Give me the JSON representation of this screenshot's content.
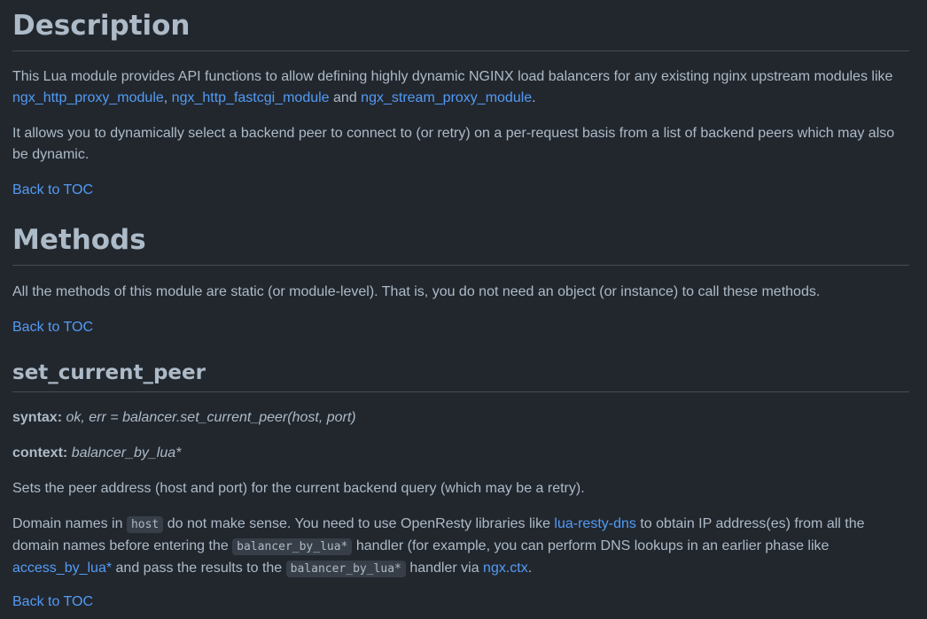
{
  "description": {
    "heading": "Description",
    "p1": {
      "text1": "This Lua module provides API functions to allow defining highly dynamic NGINX load balancers for any existing nginx upstream modules like ",
      "link1": "ngx_http_proxy_module",
      "sep1": ", ",
      "link2": "ngx_http_fastcgi_module",
      "sep2": " and ",
      "link3": "ngx_stream_proxy_module",
      "end": "."
    },
    "p2": "It allows you to dynamically select a backend peer to connect to (or retry) on a per-request basis from a list of backend peers which may also be dynamic.",
    "back_to_toc": "Back to TOC"
  },
  "methods": {
    "heading": "Methods",
    "p1": "All the methods of this module are static (or module-level). That is, you do not need an object (or instance) to call these methods.",
    "back_to_toc": "Back to TOC"
  },
  "set_current_peer": {
    "heading": "set_current_peer",
    "syntax_label": "syntax:",
    "syntax_value": "ok, err = balancer.set_current_peer(host, port)",
    "context_label": "context:",
    "context_value": "balancer_by_lua*",
    "p1": "Sets the peer address (host and port) for the current backend query (which may be a retry).",
    "p2": {
      "t1": "Domain names in ",
      "code1": "host",
      "t2": " do not make sense. You need to use OpenResty libraries like ",
      "link1": "lua-resty-dns",
      "t3": " to obtain IP address(es) from all the domain names before entering the ",
      "code2": "balancer_by_lua*",
      "t4": " handler (for example, you can perform DNS lookups in an earlier phase like ",
      "link2": "access_by_lua*",
      "t5": " and pass the results to the ",
      "code3": "balancer_by_lua*",
      "t6": " handler via ",
      "link3": "ngx.ctx",
      "t7": "."
    },
    "back_to_toc": "Back to TOC"
  }
}
